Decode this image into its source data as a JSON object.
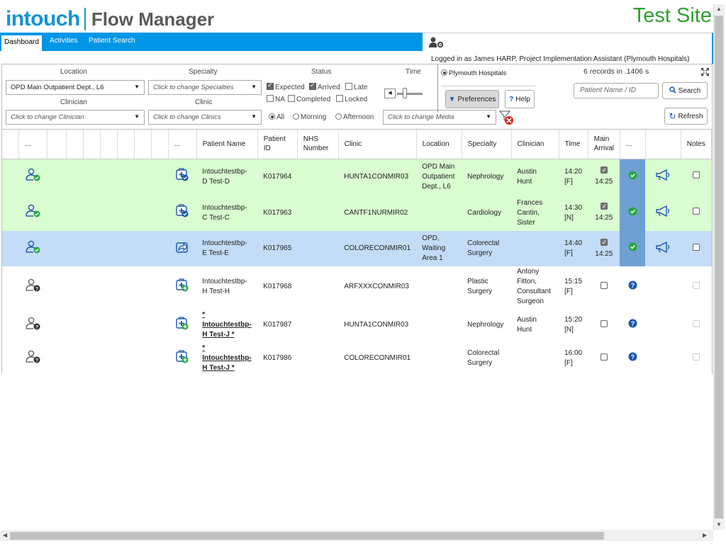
{
  "header": {
    "logo_part1": "intouch",
    "logo_part2": "Flow Manager",
    "site": "Test Site"
  },
  "nav": {
    "tabs": [
      "Dashboard",
      "Activities",
      "Patient Search"
    ]
  },
  "user": {
    "logged_in": "Logged in as James HARP, Project Implementation Assistant (Plymouth Hospitals)",
    "icon": "user-settings-icon"
  },
  "filters": {
    "location_label": "Location",
    "location_value": "OPD Main Outpatient Dept., L6",
    "specialty_label": "Specialty",
    "specialty_placeholder": "Click to change Specialties",
    "clinician_label": "Clinician",
    "clinician_placeholder": "Click to change Clinician",
    "clinic_label": "Clinic",
    "clinic_placeholder": "Click to change Clinics",
    "status_label": "Status",
    "status": {
      "expected": "Expected",
      "arrived": "Arrived",
      "late": "Late",
      "na": "NA",
      "completed": "Completed",
      "locked": "Locked"
    },
    "time_label": "Time",
    "time_all": "All",
    "time_morning": "Morning",
    "time_afternoon": "Afternoon",
    "media_placeholder": "Click to change Media",
    "org": "Plymouth Hospitals",
    "records": "6 records in .1406 s",
    "preferences": "Preferences",
    "help": "Help",
    "patient_placeholder": "Patient Name / ID",
    "search": "Search",
    "refresh": "Refresh"
  },
  "grid": {
    "columns": [
      "...",
      "...",
      "Patient Name",
      "Patient ID",
      "NHS Number",
      "Clinic",
      "Location",
      "Specialty",
      "Clinician",
      "Time",
      "Main Arrival",
      "...",
      "Notes"
    ],
    "rows": [
      {
        "state": "green",
        "name": "Intouchtestbp-D Test-D",
        "underline": false,
        "pid": "K017964",
        "nhs": "",
        "clinic": "HUNTA1CONMIR03",
        "location": "OPD Main Outpatient Dept., L6",
        "specialty": "Nephrology",
        "clinician": "Austin Hunt",
        "time": "14:20 [F]",
        "arrival_time": "14:25",
        "arrived": true,
        "status_icon": "check-circle-icon"
      },
      {
        "state": "green",
        "name": "Intouchtestbp-C Test-C",
        "underline": false,
        "pid": "K017963",
        "nhs": "",
        "clinic": "CANTF1NURMIR02",
        "location": "",
        "specialty": "Cardiology",
        "clinician": "Frances Cantin, Sister",
        "time": "14:30 [N]",
        "arrival_time": "14:25",
        "arrived": true,
        "status_icon": "check-circle-icon"
      },
      {
        "state": "blue",
        "name": "Intouchtestbp-E Test-E",
        "underline": false,
        "pid": "K017965",
        "nhs": "",
        "clinic": "COLORECONMIR01",
        "location": "OPD, Waiting Area 1",
        "specialty": "Colorectal Surgery",
        "clinician": "",
        "time": "14:40 [F]",
        "arrival_time": "14:25",
        "arrived": true,
        "status_icon": "check-circle-icon"
      },
      {
        "state": "white",
        "name": "Intouchtestbp-H Test-H",
        "underline": false,
        "pid": "K017968",
        "nhs": "",
        "clinic": "ARFXXXCONMIR03",
        "location": "",
        "specialty": "Plastic Surgery",
        "clinician": "Antony Fitton, Consultant Surgeon",
        "time": "15:15 [F]",
        "arrival_time": "",
        "arrived": false,
        "status_icon": "question-circle-icon"
      },
      {
        "state": "white",
        "name": "* Intouchtestbp-H Test-J *",
        "underline": true,
        "pid": "K017987",
        "nhs": "",
        "clinic": "HUNTA1CONMIR03",
        "location": "",
        "specialty": "Nephrology",
        "clinician": "Austin Hunt",
        "time": "15:20 [N]",
        "arrival_time": "",
        "arrived": false,
        "status_icon": "question-circle-icon"
      },
      {
        "state": "white",
        "name": "* Intouchtestbp-H Test-J *",
        "underline": true,
        "pid": "K017986",
        "nhs": "",
        "clinic": "COLORECONMIR01",
        "location": "",
        "specialty": "Colorectal Surgery",
        "clinician": "",
        "time": "16:00 [F]",
        "arrival_time": "",
        "arrived": false,
        "status_icon": "question-circle-icon"
      }
    ]
  },
  "colors": {
    "brand": "#1592d6",
    "site": "#2ea02e",
    "nav": "#0096e6",
    "row_green": "#d9fcd0",
    "row_blue": "#c3dcf7",
    "status_col": "#6fa0d2",
    "check_green": "#28a745",
    "question_blue": "#1a56b0"
  }
}
